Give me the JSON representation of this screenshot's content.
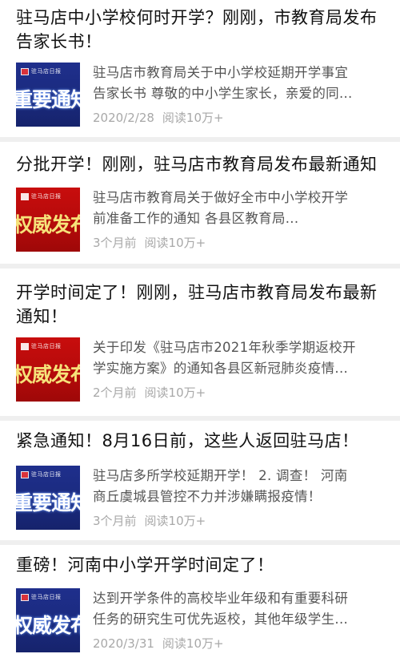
{
  "articles": [
    {
      "title": "驻马店中小学校何时开学？刚刚，市教育局发布告家长书！",
      "thumb": {
        "style": "blue",
        "logo": "驻马店日报",
        "text": "重要通知"
      },
      "snippet_line1": "驻马店市教育局关于中小学校延期开学事宜",
      "snippet_line2": "告家长书 尊敬的中小学生家长，亲爱的同...",
      "date": "2020/2/28",
      "reads": "阅读10万+"
    },
    {
      "title": "分批开学！刚刚，驻马店市教育局发布最新通知",
      "thumb": {
        "style": "red",
        "logo": "驻马店日报",
        "text": "权威发布"
      },
      "snippet_line1": "驻马店市教育局关于做好全市中小学校开学",
      "snippet_line2": "前准备工作的通知 各县区教育局...",
      "date": "3个月前",
      "reads": "阅读10万+"
    },
    {
      "title": "开学时间定了！刚刚，驻马店市教育局发布最新通知！",
      "thumb": {
        "style": "red",
        "logo": "驻马店日报",
        "text": "权威发布"
      },
      "snippet_line1": "关于印发《驻马店市2021年秋季学期返校开",
      "snippet_line2": "学实施方案》的通知各县区新冠肺炎疫情...",
      "date": "2个月前",
      "reads": "阅读10万+"
    },
    {
      "title": "紧急通知！8月16日前，这些人返回驻马店！",
      "thumb": {
        "style": "blue",
        "logo": "驻马店日报",
        "text": "重要通知"
      },
      "snippet_line1": "驻马店多所学校延期开学！ 2. 调查！ 河南",
      "snippet_line2": "商丘虞城县管控不力并涉嫌瞒报疫情！",
      "date": "3个月前",
      "reads": "阅读10万+"
    },
    {
      "title": "重磅！河南中小学开学时间定了！",
      "thumb": {
        "style": "blue",
        "logo": "驻马店日报",
        "text": "权威发布"
      },
      "snippet_line1": "达到开学条件的高校毕业年级和有重要科研",
      "snippet_line2": "任务的研究生可优先返校，其他年级学生...",
      "date": "2020/3/31",
      "reads": "阅读10万+"
    }
  ]
}
